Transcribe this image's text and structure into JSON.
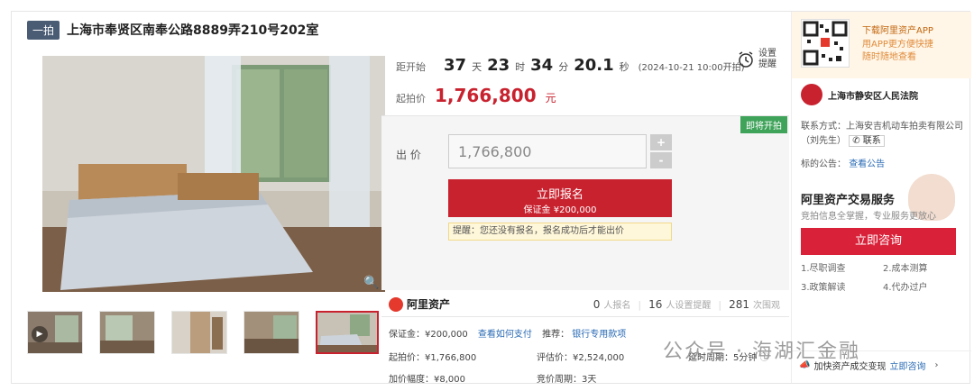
{
  "listing": {
    "tag": "一拍",
    "title": "上海市奉贤区南奉公路8889弄210号202室"
  },
  "countdown": {
    "label": "距开始",
    "days": "37",
    "days_unit": "天",
    "hours": "23",
    "hours_unit": "时",
    "minutes": "34",
    "minutes_unit": "分",
    "seconds": "20.1",
    "seconds_unit": "秒",
    "start_time": "(2024-10-21 10:00开拍)",
    "remind_label": "设置提醒"
  },
  "start_price": {
    "label": "起拍价",
    "value": "1,766,800",
    "unit": "元"
  },
  "bid": {
    "status_badge": "即将开拍",
    "label": "出 价",
    "input_value": "1,766,800",
    "plus": "+",
    "minus": "-",
    "signup_label": "立即报名",
    "deposit_label": "保证金 ¥200,000",
    "tip": "提醒：您还没有报名，报名成功后才能出价"
  },
  "platform": {
    "brand": "阿里资产",
    "signups": "0",
    "signups_label": "人报名",
    "reminders": "16",
    "reminders_label": "人设置提醒",
    "views": "281",
    "views_label": "次围观"
  },
  "details": {
    "deposit": "保证金：¥200,000",
    "how_to_pay": "查看如何支付",
    "recommend": "推荐：",
    "bank_account": "银行专用款项",
    "start_price": "起拍价：¥1,766,800",
    "appraisal": "评估价：¥2,524,000",
    "extension": "延时周期：5分钟",
    "increment": "加价幅度：¥8,000",
    "auction_period": "竞价周期：3天"
  },
  "sidebar": {
    "app_title": "下载阿里资产APP",
    "app_desc_1": "用APP更方便快捷",
    "app_desc_2": "随时随地查看",
    "court_name": "上海市静安区人民法院",
    "contact_prefix": "联系方式：上海安吉机动车拍卖有限公司（刘先生）",
    "contact_button": "联系",
    "notice_label": "标的公告：",
    "notice_link": "查看公告",
    "service_title": "阿里资产交易服务",
    "service_sub": "竞拍信息全掌握，专业服务更放心",
    "consult_button": "立即咨询",
    "services": [
      "1.尽职调查",
      "2.成本测算",
      "3.政策解读",
      "4.代办过户"
    ],
    "bottom_text": "加快资产成交变现",
    "bottom_link": "立即咨询"
  },
  "watermark": "公众号 · 海湖汇金融"
}
